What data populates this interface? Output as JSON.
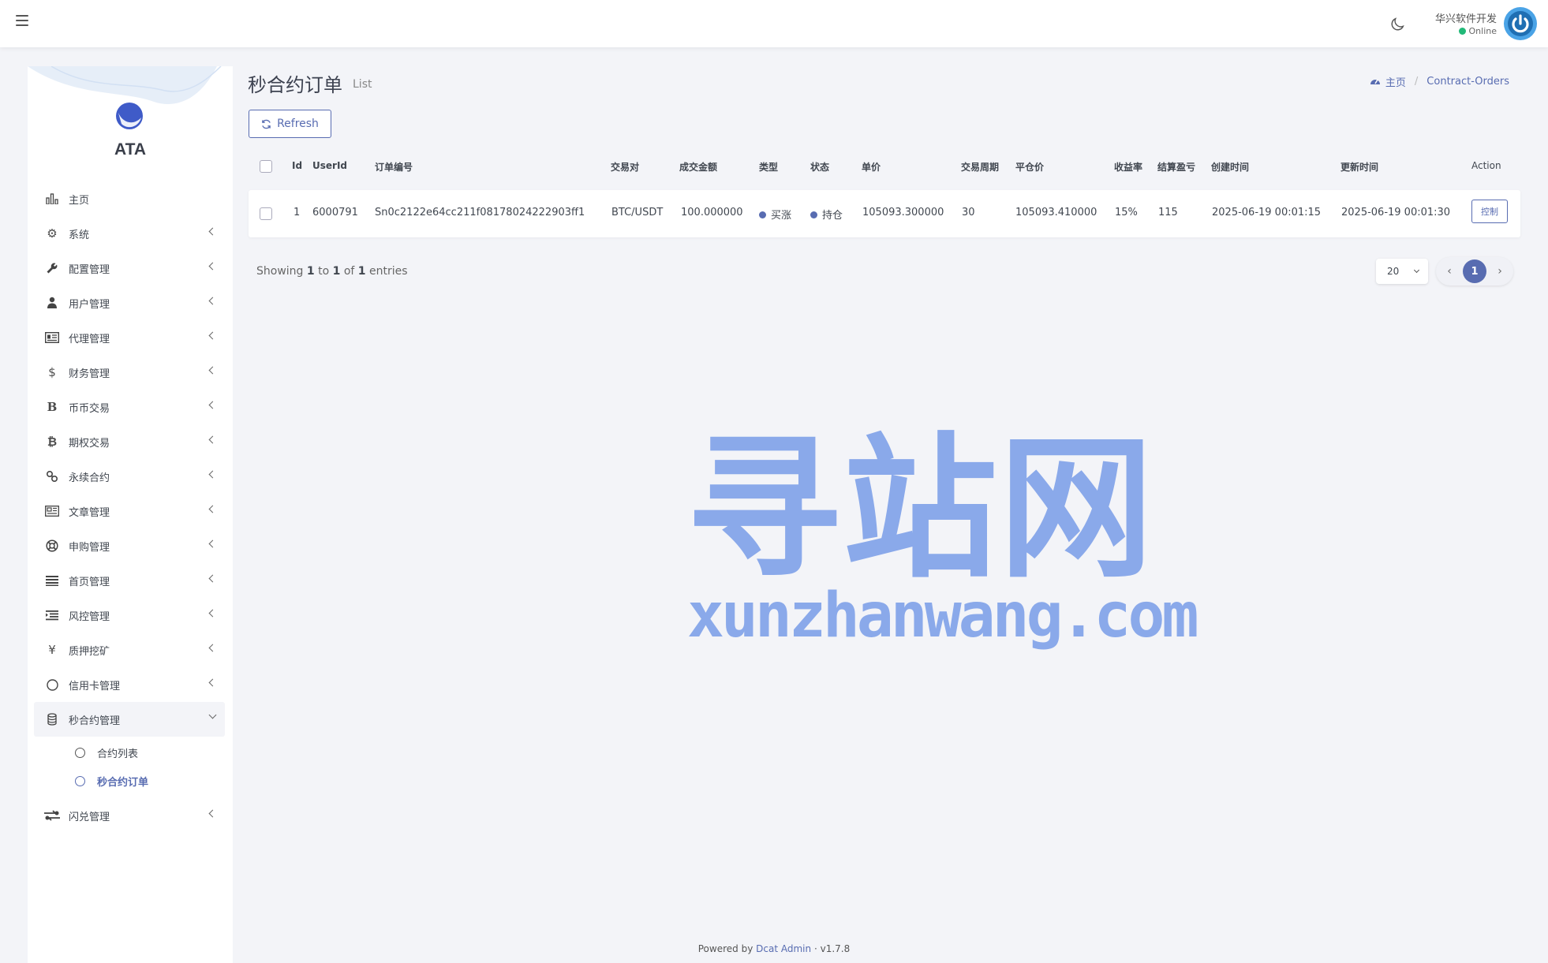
{
  "header": {
    "user_name": "华兴软件开发",
    "user_status": "Online"
  },
  "sidebar": {
    "brand": "ATA",
    "items": [
      {
        "label": "主页",
        "icon": "bar-chart-icon"
      },
      {
        "label": "系统",
        "icon": "gear-icon"
      },
      {
        "label": "配置管理",
        "icon": "wrench-icon"
      },
      {
        "label": "用户管理",
        "icon": "user-tie-icon"
      },
      {
        "label": "代理管理",
        "icon": "id-card-icon"
      },
      {
        "label": "财务管理",
        "icon": "dollar-icon"
      },
      {
        "label": "币币交易",
        "icon": "b-letter-icon"
      },
      {
        "label": "期权交易",
        "icon": "bitcoin-icon"
      },
      {
        "label": "永续合约",
        "icon": "link-icon"
      },
      {
        "label": "文章管理",
        "icon": "newspaper-icon"
      },
      {
        "label": "申购管理",
        "icon": "lifebuoy-icon"
      },
      {
        "label": "首页管理",
        "icon": "bars-icon"
      },
      {
        "label": "风控管理",
        "icon": "indent-icon"
      },
      {
        "label": "质押挖矿",
        "icon": "yen-icon"
      },
      {
        "label": "信用卡管理",
        "icon": "circle-icon"
      },
      {
        "label": "秒合约管理",
        "icon": "coins-icon"
      }
    ],
    "sub_items": [
      {
        "label": "合约列表"
      },
      {
        "label": "秒合约订单"
      }
    ],
    "last_item": {
      "label": "闪兑管理",
      "icon": "exchange-icon"
    }
  },
  "page": {
    "title": "秒合约订单",
    "subtitle": "List",
    "refresh_label": "Refresh"
  },
  "breadcrumb": {
    "home": "主页",
    "current": "Contract-Orders"
  },
  "table": {
    "columns": [
      "Id",
      "UserId",
      "订单编号",
      "交易对",
      "成交金额",
      "类型",
      "状态",
      "单价",
      "交易周期",
      "平仓价",
      "收益率",
      "结算盈亏",
      "创建时间",
      "更新时间",
      "Action"
    ],
    "rows": [
      {
        "id": "1",
        "user_id": "6000791",
        "order_no": "Sn0c2122e64cc211f08178024222903ff1",
        "pair": "BTC/USDT",
        "amount": "100.000000",
        "type": "买涨",
        "status": "持仓",
        "price": "105093.300000",
        "period": "30",
        "close_price": "105093.410000",
        "yield": "15%",
        "pnl": "115",
        "created_at": "2025-06-19 00:01:15",
        "updated_at": "2025-06-19 00:01:30",
        "action": "控制"
      }
    ]
  },
  "pagination": {
    "showing_prefix": "Showing",
    "from": "1",
    "to_word": "to",
    "to": "1",
    "of_word": "of",
    "total": "1",
    "entries_word": "entries",
    "per_page": "20",
    "current_page": "1"
  },
  "watermark": {
    "cn": "寻站网",
    "en": "xunzhanwang.com"
  },
  "footer": {
    "powered_by": "Powered by",
    "product": "Dcat Admin",
    "sep": "·",
    "version": "v1.7.8"
  },
  "colors": {
    "primary": "#586cb1",
    "online": "#21b978",
    "background": "#f3f4f8",
    "watermark": "#8aa9ea"
  }
}
